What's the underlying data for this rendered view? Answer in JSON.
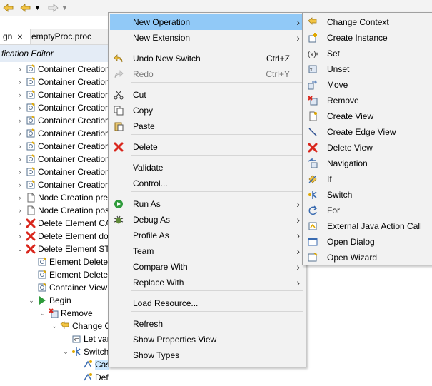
{
  "toolbar": {
    "icons": [
      "back-arrow-icon",
      "forward-arrow-icon",
      "dropdown-icon"
    ]
  },
  "tabs": {
    "active_label": "gn",
    "close_glyph": "✕",
    "second_label": "emptyProc.proc"
  },
  "editor": {
    "header": "fication Editor"
  },
  "tree": [
    {
      "label": "Container Creation",
      "icon": "gear-icon",
      "twisty": "›"
    },
    {
      "label": "Container Creation",
      "icon": "gear-icon",
      "twisty": "›"
    },
    {
      "label": "Container Creation",
      "icon": "gear-icon",
      "twisty": "›"
    },
    {
      "label": "Container Creation",
      "icon": "gear-icon",
      "twisty": "›"
    },
    {
      "label": "Container Creation",
      "icon": "gear-icon",
      "twisty": "›"
    },
    {
      "label": "Container Creation",
      "icon": "gear-icon",
      "twisty": "›"
    },
    {
      "label": "Container Creation",
      "icon": "gear-icon",
      "twisty": "›"
    },
    {
      "label": "Container Creation",
      "icon": "gear-icon",
      "twisty": "›"
    },
    {
      "label": "Container Creation",
      "icon": "gear-icon",
      "twisty": "›"
    },
    {
      "label": "Container Creation",
      "icon": "gear-icon",
      "twisty": "›"
    },
    {
      "label": "Node Creation pre",
      "icon": "page-icon",
      "twisty": "›"
    },
    {
      "label": "Node Creation pos",
      "icon": "page-icon",
      "twisty": "›"
    },
    {
      "label": "Delete Element CA",
      "icon": "red-x-icon",
      "twisty": "›"
    },
    {
      "label": "Delete Element do",
      "icon": "red-x-icon",
      "twisty": "›"
    },
    {
      "label": "Delete Element STA",
      "icon": "red-x-icon",
      "twisty": "⌄"
    },
    {
      "label": "Element Delete",
      "icon": "gear-icon",
      "twisty": ""
    },
    {
      "label": "Element Delete",
      "icon": "gear-icon",
      "twisty": ""
    },
    {
      "label": "Container View",
      "icon": "gear-icon",
      "twisty": ""
    },
    {
      "label": "Begin",
      "icon": "play-icon",
      "twisty": "⌄"
    },
    {
      "label": "Remove",
      "icon": "remove-icon",
      "twisty": "⌄"
    },
    {
      "label": "Change C",
      "icon": "change-icon",
      "twisty": "⌄"
    },
    {
      "label": "Let var",
      "icon": "let-icon",
      "twisty": ""
    },
    {
      "label": "Switch",
      "icon": "switch-icon",
      "twisty": "⌄"
    },
    {
      "label": "Case",
      "icon": "case-icon",
      "twisty": ""
    },
    {
      "label": "Default",
      "icon": "case-icon",
      "twisty": ""
    }
  ],
  "context_menu": {
    "items": [
      {
        "label": "New Operation",
        "shortcut": "",
        "submenu": true,
        "icon": ""
      },
      {
        "label": "New Extension",
        "shortcut": "",
        "submenu": true,
        "icon": ""
      },
      {
        "label": "Undo New Switch",
        "shortcut": "Ctrl+Z",
        "submenu": false,
        "icon": "undo-icon"
      },
      {
        "label": "Redo",
        "shortcut": "Ctrl+Y",
        "submenu": false,
        "icon": "redo-icon"
      },
      {
        "label": "Cut",
        "shortcut": "",
        "submenu": false,
        "icon": "scissors-icon"
      },
      {
        "label": "Copy",
        "shortcut": "",
        "submenu": false,
        "icon": "copy-icon"
      },
      {
        "label": "Paste",
        "shortcut": "",
        "submenu": false,
        "icon": "paste-icon"
      },
      {
        "label": "Delete",
        "shortcut": "",
        "submenu": false,
        "icon": "delete-icon"
      },
      {
        "label": "Validate",
        "shortcut": "",
        "submenu": false,
        "icon": ""
      },
      {
        "label": "Control...",
        "shortcut": "",
        "submenu": false,
        "icon": ""
      },
      {
        "label": "Run As",
        "shortcut": "",
        "submenu": true,
        "icon": "run-icon"
      },
      {
        "label": "Debug As",
        "shortcut": "",
        "submenu": true,
        "icon": "bug-icon"
      },
      {
        "label": "Profile As",
        "shortcut": "",
        "submenu": true,
        "icon": ""
      },
      {
        "label": "Team",
        "shortcut": "",
        "submenu": true,
        "icon": ""
      },
      {
        "label": "Compare With",
        "shortcut": "",
        "submenu": true,
        "icon": ""
      },
      {
        "label": "Replace With",
        "shortcut": "",
        "submenu": true,
        "icon": ""
      },
      {
        "label": "Load Resource...",
        "shortcut": "",
        "submenu": false,
        "icon": ""
      },
      {
        "label": "Refresh",
        "shortcut": "",
        "submenu": false,
        "icon": ""
      },
      {
        "label": "Show Properties View",
        "shortcut": "",
        "submenu": false,
        "icon": ""
      },
      {
        "label": "Show Types",
        "shortcut": "",
        "submenu": false,
        "icon": ""
      }
    ]
  },
  "submenu": {
    "items": [
      {
        "label": "Change Context",
        "icon": "change-context-icon"
      },
      {
        "label": "Create Instance",
        "icon": "create-instance-icon"
      },
      {
        "label": "Set",
        "icon": "set-icon"
      },
      {
        "label": "Unset",
        "icon": "unset-icon"
      },
      {
        "label": "Move",
        "icon": "move-icon"
      },
      {
        "label": "Remove",
        "icon": "remove-icon"
      },
      {
        "label": "Create View",
        "icon": "create-view-icon"
      },
      {
        "label": "Create Edge View",
        "icon": "create-edge-view-icon"
      },
      {
        "label": "Delete View",
        "icon": "delete-view-icon"
      },
      {
        "label": "Navigation",
        "icon": "navigation-icon"
      },
      {
        "label": "If",
        "icon": "if-icon"
      },
      {
        "label": "Switch",
        "icon": "switch-icon"
      },
      {
        "label": "For",
        "icon": "for-icon"
      },
      {
        "label": "External Java Action Call",
        "icon": "java-action-icon"
      },
      {
        "label": "Open Dialog",
        "icon": "open-dialog-icon"
      },
      {
        "label": "Open Wizard",
        "icon": "open-wizard-icon"
      }
    ]
  },
  "colors": {
    "highlight": "#91c9f7",
    "menu_bg": "#f2f2f2",
    "tree_selection": "#cce8ff",
    "delete_red": "#d9261c",
    "run_green": "#2e9b3b"
  }
}
